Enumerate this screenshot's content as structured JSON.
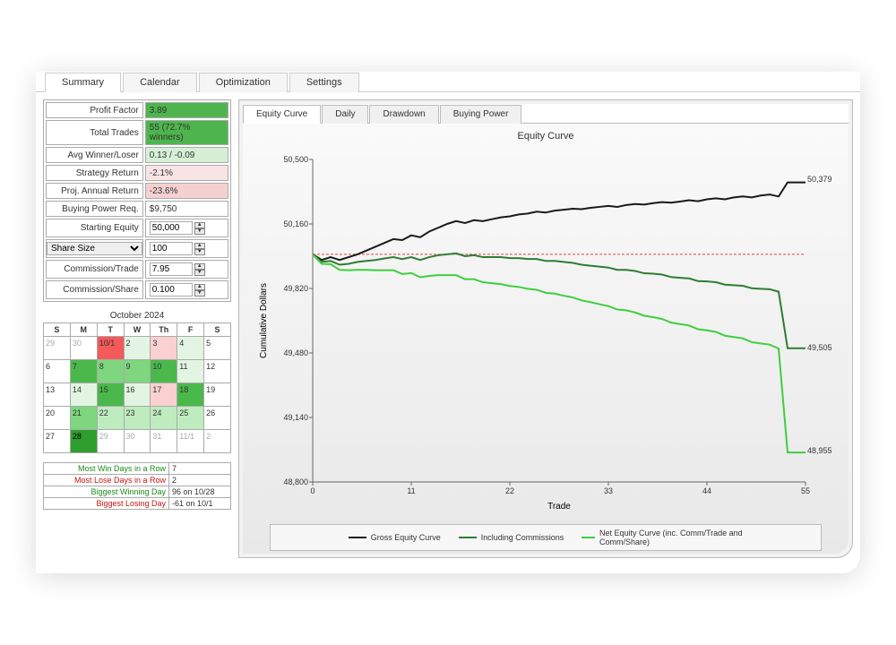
{
  "main_tabs": [
    "Summary",
    "Calendar",
    "Optimization",
    "Settings"
  ],
  "inner_tabs": [
    "Equity Curve",
    "Daily",
    "Drawdown",
    "Buying Power"
  ],
  "stats": {
    "profit_factor_l": "Profit Factor",
    "profit_factor_v": "3.89",
    "total_trades_l": "Total Trades",
    "total_trades_v": "55 (72.7% winners)",
    "avg_wl_l": "Avg Winner/Loser",
    "avg_wl_v": "0.13 / -0.09",
    "strat_ret_l": "Strategy Return",
    "strat_ret_v": "-2.1%",
    "proj_ret_l": "Proj. Annual Return",
    "proj_ret_v": "-23.6%",
    "bp_req_l": "Buying Power Req.",
    "bp_req_v": "$9,750",
    "start_eq_l": "Starting Equity",
    "start_eq_v": "50,000",
    "share_size_l": "Share Size",
    "share_size_v": "100",
    "comm_trade_l": "Commission/Trade",
    "comm_trade_v": "7.95",
    "comm_share_l": "Commission/Share",
    "comm_share_v": "0.100"
  },
  "calendar": {
    "title": "October 2024",
    "headers": [
      "S",
      "M",
      "T",
      "W",
      "Th",
      "F",
      "S"
    ]
  },
  "streaks": {
    "win_row_l": "Most Win Days in a Row",
    "win_row_v": "7",
    "lose_row_l": "Most Lose Days in a Row",
    "lose_row_v": "2",
    "big_win_l": "Biggest Winning Day",
    "big_win_v": "96 on 10/28",
    "big_lose_l": "Biggest Losing Day",
    "big_lose_v": "-61 on 10/1"
  },
  "chart": {
    "title": "Equity Curve",
    "xlabel": "Trade",
    "ylabel": "Cumulative Dollars",
    "end_labels": {
      "gross": "50,379",
      "incl": "49,505",
      "net": "48,955"
    },
    "legend": [
      "Gross Equity Curve",
      "Including Commissions",
      "Net Equity Curve (inc. Comm/Trade and Comm/Share)"
    ]
  },
  "chart_data": {
    "type": "line",
    "xlabel": "Trade",
    "ylabel": "Cumulative Dollars",
    "xlim": [
      0,
      55
    ],
    "ylim": [
      48800,
      50500
    ],
    "x_ticks": [
      0,
      11,
      22,
      33,
      44,
      55
    ],
    "y_ticks": [
      48800,
      49140,
      49480,
      49820,
      50160,
      50500
    ],
    "baseline_y": 50000,
    "series": [
      {
        "name": "Gross Equity Curve",
        "color": "#1a1a1a",
        "values": [
          50000,
          49970,
          49985,
          49970,
          49985,
          50000,
          50020,
          50040,
          50060,
          50080,
          50075,
          50100,
          50090,
          50120,
          50140,
          50160,
          50175,
          50165,
          50180,
          50175,
          50185,
          50195,
          50200,
          50210,
          50215,
          50225,
          50220,
          50230,
          50235,
          50240,
          50238,
          50245,
          50250,
          50255,
          50250,
          50260,
          50265,
          50262,
          50270,
          50275,
          50272,
          50278,
          50285,
          50280,
          50290,
          50295,
          50290,
          50300,
          50305,
          50300,
          50310,
          50315,
          50305,
          50379,
          50379,
          50379
        ]
      },
      {
        "name": "Including Commissions",
        "color": "#2E7D32",
        "values": [
          50000,
          49960,
          49965,
          49945,
          49950,
          49960,
          49965,
          49970,
          49978,
          49985,
          49975,
          49985,
          49970,
          49985,
          49995,
          50000,
          50005,
          49990,
          49995,
          49985,
          49985,
          49985,
          49980,
          49980,
          49975,
          49975,
          49965,
          49965,
          49960,
          49955,
          49945,
          49940,
          49935,
          49930,
          49918,
          49918,
          49912,
          49900,
          49898,
          49893,
          49880,
          49876,
          49873,
          49859,
          49857,
          49853,
          49840,
          49837,
          49834,
          49821,
          49818,
          49816,
          49803,
          49505,
          49505,
          49505
        ]
      },
      {
        "name": "Net Equity Curve",
        "color": "#3DCF3D",
        "values": [
          50000,
          49950,
          49948,
          49918,
          49916,
          49918,
          49918,
          49916,
          49916,
          49916,
          49896,
          49901,
          49879,
          49886,
          49890,
          49890,
          49890,
          49869,
          49869,
          49853,
          49848,
          49843,
          49833,
          49828,
          49818,
          49813,
          49797,
          49793,
          49782,
          49773,
          49757,
          49748,
          49737,
          49727,
          49709,
          49705,
          49693,
          49676,
          49669,
          49659,
          49640,
          49632,
          49625,
          49605,
          49599,
          49591,
          49571,
          49564,
          49557,
          49537,
          49530,
          49524,
          49503,
          48955,
          48955,
          48955
        ]
      }
    ]
  }
}
